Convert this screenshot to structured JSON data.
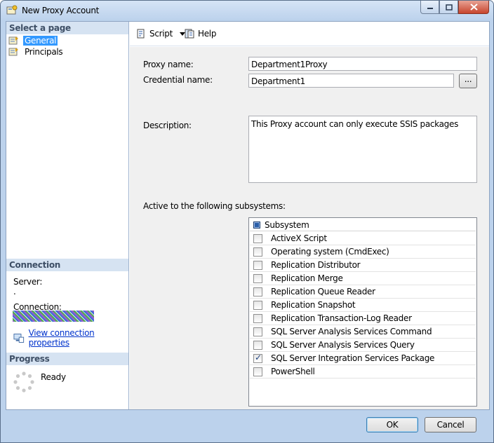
{
  "window": {
    "title": "New Proxy Account"
  },
  "left_panel": {
    "select_page_header": "Select a page",
    "pages": [
      {
        "label": "General",
        "selected": true
      },
      {
        "label": "Principals",
        "selected": false
      }
    ],
    "connection": {
      "header": "Connection",
      "server_label": "Server:",
      "server_value": ".",
      "connection_label": "Connection:",
      "view_properties_link": "View connection properties"
    },
    "progress": {
      "header": "Progress",
      "status": "Ready"
    }
  },
  "toolbar": {
    "script_label": "Script",
    "help_label": "Help"
  },
  "form": {
    "proxy_name_label": "Proxy name:",
    "proxy_name_value": "Department1Proxy",
    "credential_name_label": "Credential name:",
    "credential_name_value": "Department1",
    "browse_button_label": "...",
    "description_label": "Description:",
    "description_value": "This Proxy account can only execute SSIS packages",
    "subsystems_label": "Active to the following subsystems:",
    "subsystem_header": "Subsystem",
    "subsystems": [
      {
        "label": "ActiveX Script",
        "checked": false
      },
      {
        "label": "Operating system (CmdExec)",
        "checked": false
      },
      {
        "label": "Replication Distributor",
        "checked": false
      },
      {
        "label": "Replication Merge",
        "checked": false
      },
      {
        "label": "Replication Queue Reader",
        "checked": false
      },
      {
        "label": "Replication Snapshot",
        "checked": false
      },
      {
        "label": "Replication Transaction-Log Reader",
        "checked": false
      },
      {
        "label": "SQL Server Analysis Services Command",
        "checked": false
      },
      {
        "label": "SQL Server Analysis Services Query",
        "checked": false
      },
      {
        "label": "SQL Server Integration Services Package",
        "checked": true
      },
      {
        "label": "PowerShell",
        "checked": false
      }
    ]
  },
  "footer": {
    "ok_label": "OK",
    "cancel_label": "Cancel"
  },
  "colors": {
    "selection": "#3399ff",
    "link": "#0033cc",
    "section_header": "#d6e3f2",
    "frame": "#bcd2ec"
  }
}
